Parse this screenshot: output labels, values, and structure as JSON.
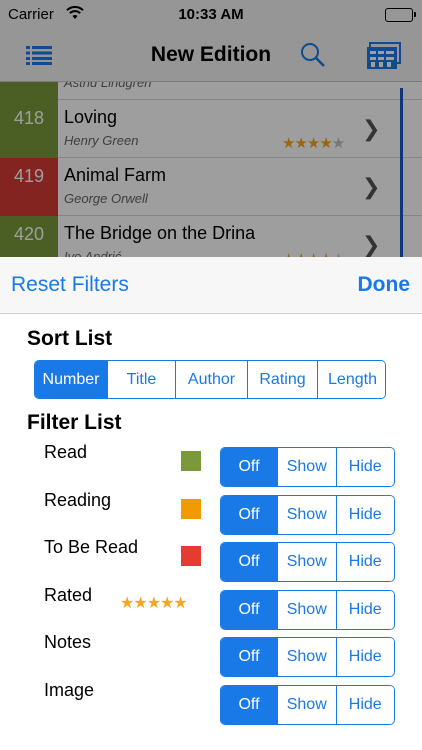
{
  "status": {
    "carrier": "Carrier",
    "time": "10:33 AM"
  },
  "nav": {
    "title": "New Edition",
    "left_icon": "list-icon",
    "search_icon": "search-icon",
    "right_icon": "books-grid-icon"
  },
  "books": {
    "partial_author": "Astrid Lindgren",
    "rows": [
      {
        "number": "418",
        "title": "Loving",
        "author": "Henry Green",
        "color": "#7a9a3a",
        "rating": 4
      },
      {
        "number": "419",
        "title": "Animal Farm",
        "author": "George Orwell",
        "color": "#d33a34"
      },
      {
        "number": "420",
        "title": "The Bridge on the Drina",
        "author": "Ivo Andrić",
        "color": "#7a9a3a",
        "rating": 4
      }
    ]
  },
  "sheet": {
    "reset_label": "Reset Filters",
    "done_label": "Done",
    "sort_title": "Sort List",
    "sort_options": [
      "Number",
      "Title",
      "Author",
      "Rating",
      "Length"
    ],
    "sort_selected": "Number",
    "filter_title": "Filter List",
    "filter_options": [
      "Off",
      "Show",
      "Hide"
    ],
    "filters": [
      {
        "label": "Read",
        "swatch": "#7a9a3a",
        "selected": "Off"
      },
      {
        "label": "Reading",
        "swatch": "#f29a00",
        "selected": "Off"
      },
      {
        "label": "To Be Read",
        "swatch": "#e63a32",
        "selected": "Off"
      },
      {
        "label": "Rated",
        "stars": "★★★★★",
        "selected": "Off"
      },
      {
        "label": "Notes",
        "selected": "Off"
      },
      {
        "label": "Image",
        "selected": "Off"
      }
    ]
  },
  "colors": {
    "accent": "#1979e6",
    "star": "#f5a623"
  }
}
